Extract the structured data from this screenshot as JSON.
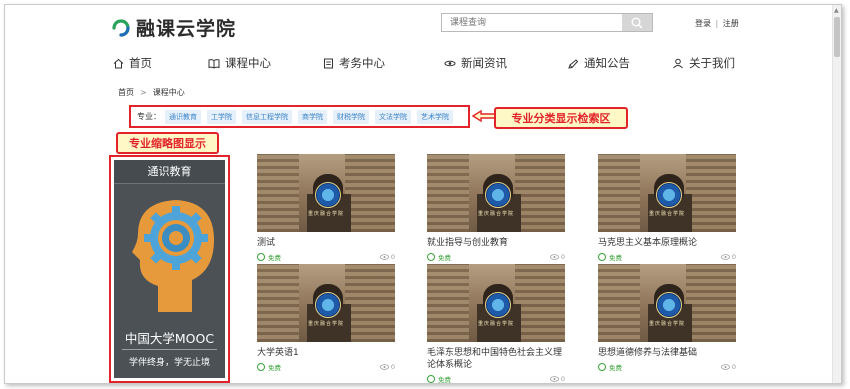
{
  "brand": {
    "name": "融课云学院",
    "accent": "#2aa35a"
  },
  "search": {
    "placeholder": "课程查询"
  },
  "auth": {
    "login": "登录",
    "sep": "|",
    "register": "注册"
  },
  "nav": [
    {
      "label": "首页",
      "icon": "home-icon"
    },
    {
      "label": "课程中心",
      "icon": "book-icon"
    },
    {
      "label": "考务中心",
      "icon": "exam-icon"
    },
    {
      "label": "新闻资讯",
      "icon": "news-icon"
    },
    {
      "label": "通知公告",
      "icon": "notice-icon"
    },
    {
      "label": "关于我们",
      "icon": "users-icon"
    }
  ],
  "breadcrumb": {
    "home": "首页",
    "sep": ">",
    "current": "课程中心"
  },
  "filter": {
    "label": "专业：",
    "tags": [
      "通识教育",
      "工学院",
      "信息工程学院",
      "商学院",
      "财税学院",
      "文法学院",
      "艺术学院"
    ]
  },
  "annotations": {
    "filter_callout": "专业分类显示检索区",
    "thumb_callout": "专业缩略图显示",
    "color": "#e2242a"
  },
  "sidebar": {
    "title": "通识教育",
    "brand": "中国大学MOOC",
    "slogan": "学伴终身，学无止境"
  },
  "thumb_caption": "重庆融合学院",
  "courses": [
    {
      "title": "测试",
      "free": "免费",
      "views": "0"
    },
    {
      "title": "就业指导与创业教育",
      "free": "免费",
      "views": "0"
    },
    {
      "title": "马克思主义基本原理概论",
      "free": "免费",
      "views": "0"
    },
    {
      "title": "大学英语1",
      "free": "免费",
      "views": "0"
    },
    {
      "title": "毛泽东思想和中国特色社会主义理论体系概论",
      "free": "免费",
      "views": "0"
    },
    {
      "title": "思想道德修养与法律基础",
      "free": "免费",
      "views": "0"
    }
  ]
}
